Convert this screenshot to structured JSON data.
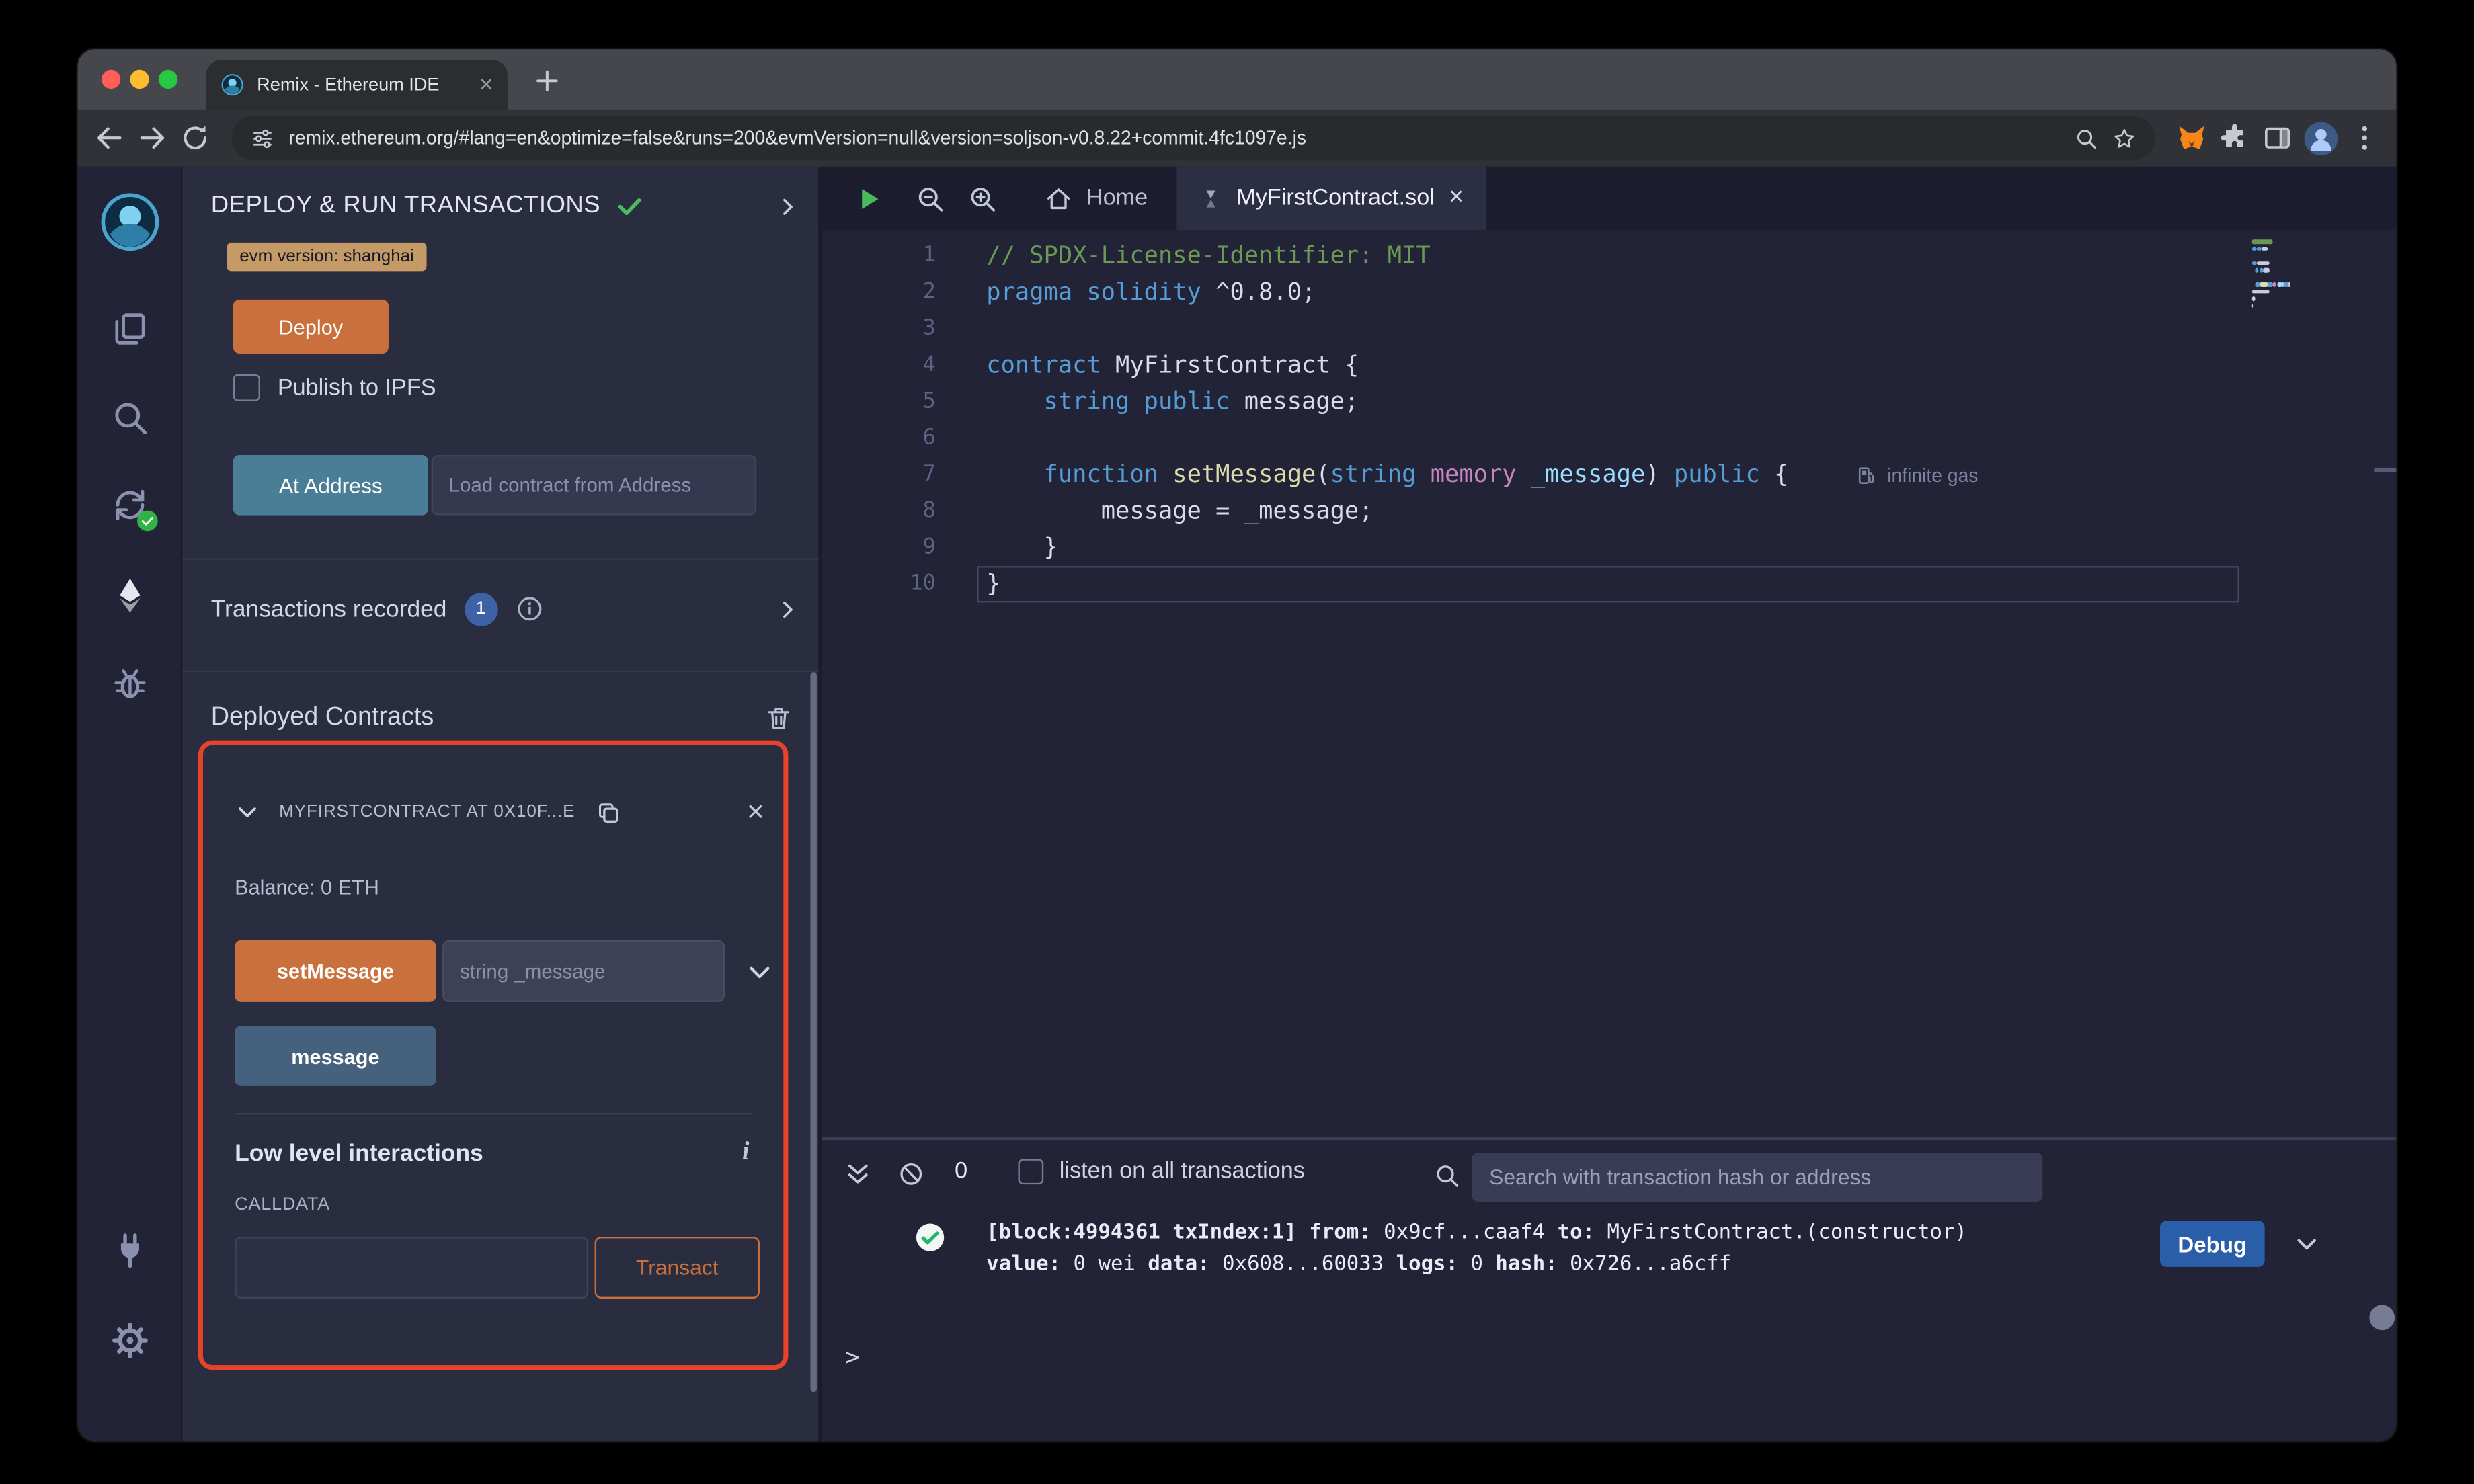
{
  "colors": {
    "orange": "#c9703c",
    "badge_tan": "#c49a66",
    "teal_btn": "#4a7e97",
    "steel_btn": "#45617d",
    "red_box": "#e8432a",
    "debug_blue": "#2a5ea8",
    "green": "#46c05a",
    "panel_bg": "#2a2c3f",
    "editor_bg": "#222336"
  },
  "browser": {
    "tab_title": "Remix - Ethereum IDE",
    "url": "remix.ethereum.org/#lang=en&optimize=false&runs=200&evmVersion=null&version=soljson-v0.8.22+commit.4fc1097e.js"
  },
  "icon_sidebar": {
    "items": [
      "remix-logo",
      "file-explorer",
      "search",
      "solidity-compiler",
      "deploy-and-run",
      "debugger",
      "plugin-manager",
      "settings"
    ]
  },
  "side_panel": {
    "title": "DEPLOY & RUN TRANSACTIONS",
    "evm_badge": "evm version: shanghai",
    "deploy_label": "Deploy",
    "publish_label": "Publish to IPFS",
    "at_address_label": "At Address",
    "at_address_placeholder": "Load contract from Address",
    "tx_recorded_label": "Transactions recorded",
    "tx_count": "1",
    "deployed_title": "Deployed Contracts",
    "contract": {
      "name": "MYFIRSTCONTRACT AT 0X10F...E",
      "balance": "Balance: 0 ETH",
      "set_message_label": "setMessage",
      "set_message_placeholder": "string _message",
      "message_label": "message",
      "low_level_title": "Low level interactions",
      "calldata_label": "CALLDATA",
      "transact_label": "Transact"
    }
  },
  "editor": {
    "tab_home": "Home",
    "tab_file": "MyFirstContract.sol",
    "gas": "infinite gas",
    "lines": [
      {
        "n": 1,
        "tokens": [
          {
            "t": "// SPDX-License-Identifier: MIT",
            "c": "cm"
          }
        ]
      },
      {
        "n": 2,
        "tokens": [
          {
            "t": "pragma",
            "c": "kw"
          },
          {
            "t": " ",
            "c": "pl"
          },
          {
            "t": "solidity",
            "c": "kw"
          },
          {
            "t": " ^0.8.0;",
            "c": "pl"
          }
        ]
      },
      {
        "n": 3,
        "tokens": []
      },
      {
        "n": 4,
        "tokens": [
          {
            "t": "contract",
            "c": "kw"
          },
          {
            "t": " MyFirstContract {",
            "c": "pl"
          }
        ]
      },
      {
        "n": 5,
        "tokens": [
          {
            "t": "    ",
            "c": "pl"
          },
          {
            "t": "string",
            "c": "kw"
          },
          {
            "t": " ",
            "c": "pl"
          },
          {
            "t": "public",
            "c": "kw"
          },
          {
            "t": " message;",
            "c": "pl"
          }
        ]
      },
      {
        "n": 6,
        "tokens": []
      },
      {
        "n": 7,
        "tokens": [
          {
            "t": "    ",
            "c": "pl"
          },
          {
            "t": "function",
            "c": "kw"
          },
          {
            "t": " ",
            "c": "pl"
          },
          {
            "t": "setMessage",
            "c": "fn"
          },
          {
            "t": "(",
            "c": "pl"
          },
          {
            "t": "string",
            "c": "kw"
          },
          {
            "t": " ",
            "c": "pl"
          },
          {
            "t": "memory",
            "c": "md"
          },
          {
            "t": " ",
            "c": "pl"
          },
          {
            "t": "_message",
            "c": "pr"
          },
          {
            "t": ") ",
            "c": "pl"
          },
          {
            "t": "public",
            "c": "kw"
          },
          {
            "t": " {",
            "c": "pl"
          }
        ]
      },
      {
        "n": 8,
        "tokens": [
          {
            "t": "        message = _message;",
            "c": "pl"
          }
        ]
      },
      {
        "n": 9,
        "tokens": [
          {
            "t": "    }",
            "c": "pl"
          }
        ]
      },
      {
        "n": 10,
        "tokens": [
          {
            "t": "}",
            "c": "pl"
          }
        ]
      }
    ]
  },
  "terminal": {
    "count": "0",
    "listen_label": "listen on all transactions",
    "search_placeholder": "Search with transaction hash or address",
    "log_line1": [
      {
        "t": "[block:4994361 txIndex:1]",
        "b": true
      },
      {
        "t": " ",
        "b": false
      },
      {
        "t": "from:",
        "b": true
      },
      {
        "t": " 0x9cf...caaf4 ",
        "b": false
      },
      {
        "t": "to:",
        "b": true
      },
      {
        "t": " MyFirstContract.(constructor)",
        "b": false
      }
    ],
    "log_line2": [
      {
        "t": "value:",
        "b": true
      },
      {
        "t": " 0 wei ",
        "b": false
      },
      {
        "t": "data:",
        "b": true
      },
      {
        "t": " 0x608...60033 ",
        "b": false
      },
      {
        "t": "logs:",
        "b": true
      },
      {
        "t": " 0 ",
        "b": false
      },
      {
        "t": "hash:",
        "b": true
      },
      {
        "t": " 0x726...a6cff",
        "b": false
      }
    ],
    "debug_label": "Debug",
    "prompt": ">"
  }
}
